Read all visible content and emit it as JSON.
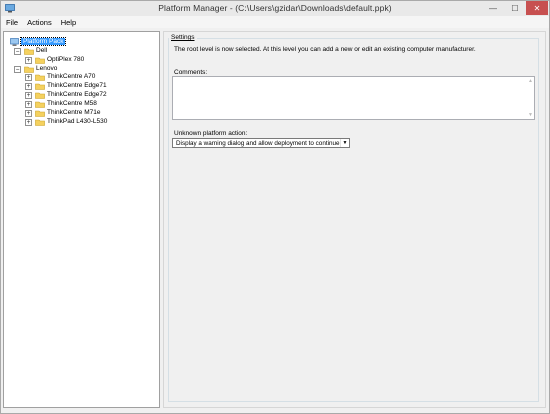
{
  "window": {
    "title": "Platform Manager - (C:\\Users\\gzidar\\Downloads\\default.ppk)",
    "minimize_glyph": "—",
    "maximize_glyph": "☐",
    "close_glyph": "✕"
  },
  "menu": {
    "items": [
      "File",
      "Actions",
      "Help"
    ]
  },
  "tree": {
    "root": "Platform Pack",
    "nodes": [
      {
        "label": "Dell",
        "expander": "−",
        "icon": "folder-icon"
      },
      {
        "label": "OptiPlex 780",
        "expander": "+",
        "icon": "folder-icon"
      },
      {
        "label": "Lenovo",
        "expander": "−",
        "icon": "folder-icon"
      },
      {
        "label": "ThinkCentre A70",
        "expander": "+",
        "icon": "folder-icon"
      },
      {
        "label": "ThinkCentre Edge71",
        "expander": "+",
        "icon": "folder-icon"
      },
      {
        "label": "ThinkCentre Edge72",
        "expander": "+",
        "icon": "folder-icon"
      },
      {
        "label": "ThinkCentre M58",
        "expander": "+",
        "icon": "folder-icon"
      },
      {
        "label": "ThinkCentre M71e",
        "expander": "+",
        "icon": "folder-icon"
      },
      {
        "label": "ThinkPad L430-L530",
        "expander": "+",
        "icon": "folder-icon"
      }
    ]
  },
  "settings": {
    "group_label": "Settings",
    "status_text": "The root level is now selected. At this level you can add a new or edit an existing computer manufacturer.",
    "comments_label": "Comments:",
    "comments_value": "",
    "unknown_action_label": "Unknown platform action:",
    "unknown_action_value": "Display a warning dialog and allow deployment to continue"
  },
  "colors": {
    "selection": "#3399ff",
    "folder": "#f5d15e",
    "close_button": "#c75050"
  }
}
